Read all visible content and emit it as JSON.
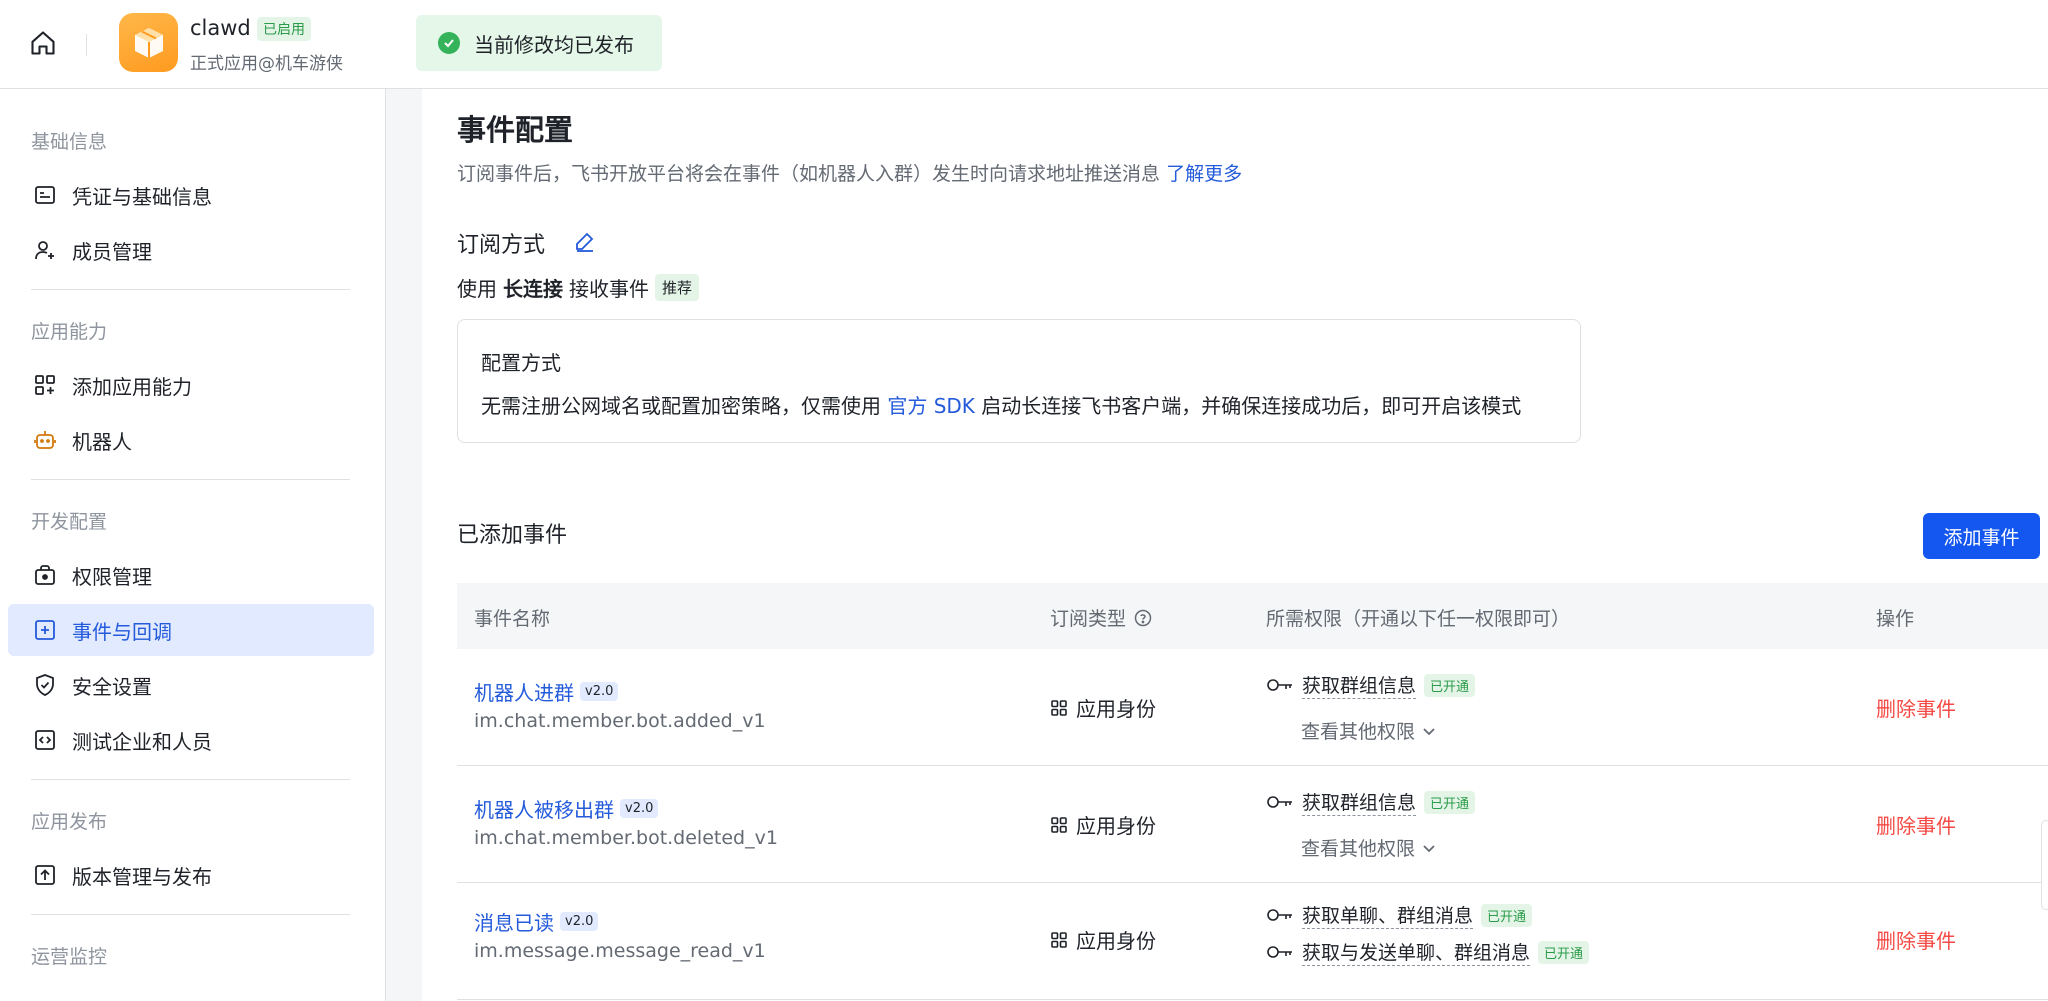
{
  "header": {
    "app_name": "clawd",
    "app_status": "已启用",
    "app_subtitle": "正式应用@机车游侠",
    "toast": "当前修改均已发布"
  },
  "sidebar": {
    "groups": [
      "基础信息",
      "应用能力",
      "开发配置",
      "应用发布",
      "运营监控"
    ],
    "items": [
      {
        "label": "凭证与基础信息",
        "icon": "credential-icon"
      },
      {
        "label": "成员管理",
        "icon": "user-add-icon"
      },
      {
        "label": "添加应用能力",
        "icon": "grid-add-icon"
      },
      {
        "label": "机器人",
        "icon": "robot-icon"
      },
      {
        "label": "权限管理",
        "icon": "lock-bag-icon"
      },
      {
        "label": "事件与回调",
        "icon": "event-icon"
      },
      {
        "label": "安全设置",
        "icon": "shield-icon"
      },
      {
        "label": "测试企业和人员",
        "icon": "code-icon"
      },
      {
        "label": "版本管理与发布",
        "icon": "upload-icon"
      }
    ],
    "active_item": "事件与回调"
  },
  "main": {
    "title": "事件配置",
    "desc": "订阅事件后，飞书开放平台将会在事件（如机器人入群）发生时向请求地址推送消息",
    "learn_more": "了解更多",
    "subscribe_title": "订阅方式",
    "subscribe_prefix": "使用",
    "subscribe_mode": "长连接",
    "subscribe_suffix": "接收事件",
    "recommend_tag": "推荐",
    "config_title": "配置方式",
    "config_text_1": "无需注册公网域名或配置加密策略，仅需使用",
    "config_link": "官方 SDK",
    "config_text_2": "启动长连接飞书客户端，并确保连接成功后，即可开启该模式",
    "added_title": "已添加事件",
    "add_button": "添加事件"
  },
  "table": {
    "headers": {
      "name": "事件名称",
      "type": "订阅类型",
      "perms": "所需权限（开通以下任一权限即可）",
      "action": "操作"
    },
    "rows": [
      {
        "name": "机器人进群",
        "version": "v2.0",
        "key": "im.chat.member.bot.added_v1",
        "type": "应用身份",
        "perm1": "获取群组信息",
        "perm1_status": "已开通",
        "more": "查看其他权限",
        "action": "删除事件"
      },
      {
        "name": "机器人被移出群",
        "version": "v2.0",
        "key": "im.chat.member.bot.deleted_v1",
        "type": "应用身份",
        "perm1": "获取群组信息",
        "perm1_status": "已开通",
        "more": "查看其他权限",
        "action": "删除事件"
      },
      {
        "name": "消息已读",
        "version": "v2.0",
        "key": "im.message.message_read_v1",
        "type": "应用身份",
        "perm1": "获取单聊、群组消息",
        "perm1_status": "已开通",
        "perm2": "获取与发送单聊、群组消息",
        "perm2_status": "已开通",
        "action": "删除事件"
      }
    ]
  },
  "colors": {
    "accent": "#1456f0",
    "link": "#245bdb",
    "danger": "#f54a45",
    "success": "#34b35a",
    "active_bg": "#e1eaff"
  }
}
